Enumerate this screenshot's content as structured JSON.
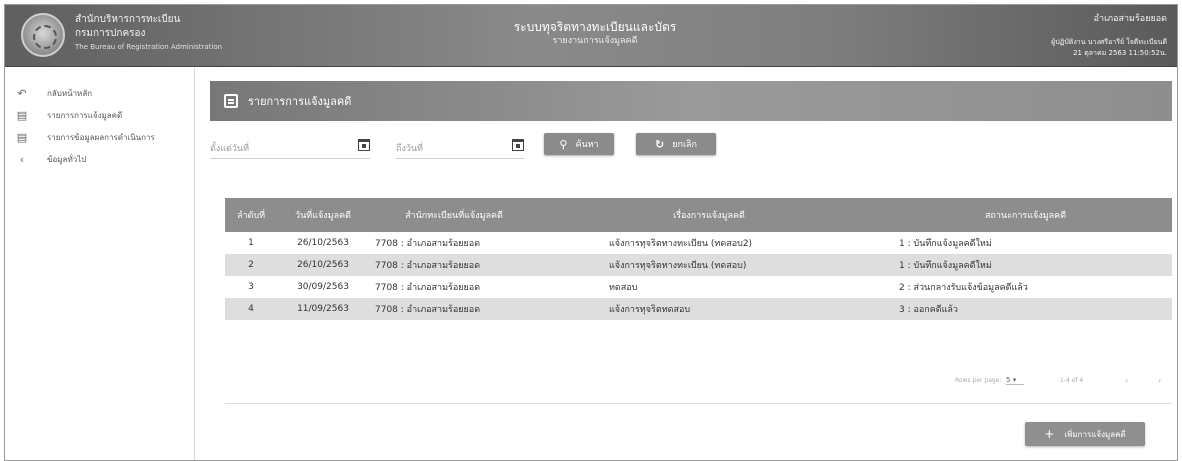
{
  "header": {
    "org_line1": "สำนักบริหารการทะเบียน",
    "org_line2": "กรมการปกครอง",
    "org_line3": "The Bureau of Registration Administration",
    "app_title": "ระบบทุจริตทางทะเบียนและบัตร",
    "app_subtitle": "รายงานการแจ้งมูลคดี",
    "office": "อำเภอสามร้อยยอด",
    "user_info": "ผู้ปฏิบัติงาน นางศรีอารีย์ ใจดีทะเบียนดี",
    "datetime": "21 ตุลาคม 2563 11:50:52น."
  },
  "sidebar": {
    "items": [
      {
        "icon": "back-icon",
        "label": "กลับหน้าหลัก"
      },
      {
        "icon": "list-icon",
        "label": "รายการการแจ้งมูลคดี"
      },
      {
        "icon": "list-icon",
        "label": "รายการข้อมูลผลการดำเนินการ"
      },
      {
        "icon": "chevron-left-icon",
        "label": "ข้อมูลทั่วไป"
      }
    ]
  },
  "card": {
    "title": "รายการการแจ้งมูลคดี"
  },
  "filters": {
    "start_placeholder": "ตั้งแต่วันที่",
    "end_placeholder": "ถึงวันที่",
    "search_label": "ค้นหา",
    "reset_label": "ยกเลิก"
  },
  "table": {
    "headers": [
      "ลำดับที่",
      "วันที่แจ้งมูลคดี",
      "สำนักทะเบียนที่แจ้งมูลคดี",
      "เรื่องการแจ้งมูลคดี",
      "สถานะการแจ้งมูลคดี"
    ],
    "rows": [
      [
        "1",
        "26/10/2563",
        "7708 : อำเภอสามร้อยยอด",
        "แจ้งการทุจริตทางทะเบียน (ทดสอบ2)",
        "1 : บันทึกแจ้งมูลคดีใหม่"
      ],
      [
        "2",
        "26/10/2563",
        "7708 : อำเภอสามร้อยยอด",
        "แจ้งการทุจริตทางทะเบียน (ทดสอบ)",
        "1 : บันทึกแจ้งมูลคดีใหม่"
      ],
      [
        "3",
        "30/09/2563",
        "7708 : อำเภอสามร้อยยอด",
        "ทดสอบ",
        "2 : ส่วนกลางรับแจ้งข้อมูลคดีแล้ว"
      ],
      [
        "4",
        "11/09/2563",
        "7708 : อำเภอสามร้อยยอด",
        "แจ้งการทุจริตทดสอบ",
        "3 : ออกคดีแล้ว"
      ]
    ]
  },
  "pager": {
    "rows_per_page_label": "Rows per page:",
    "rows_per_page_value": "5",
    "range": "1-4 of 4"
  },
  "add_button_label": "เพิ่มการแจ้งมูลคดี"
}
